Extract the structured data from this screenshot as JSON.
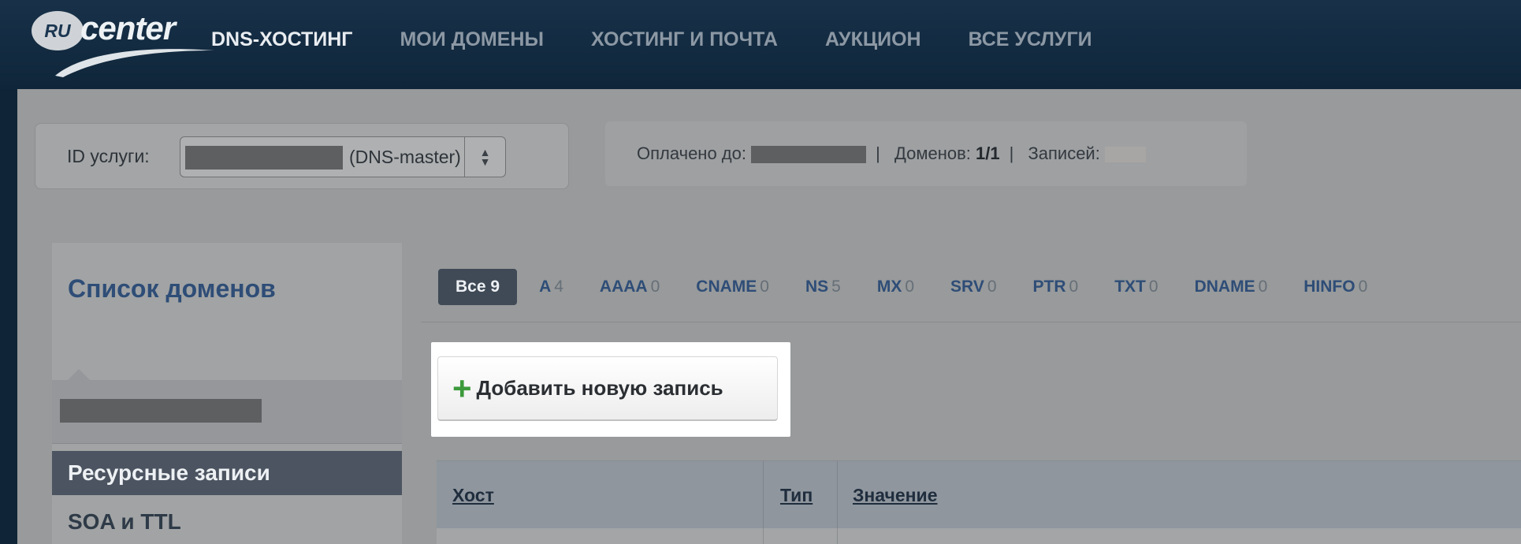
{
  "logo": {
    "badge": "RU",
    "word": "center"
  },
  "nav": {
    "items": [
      {
        "label": "DNS-ХОСТИНГ",
        "active": true
      },
      {
        "label": "МОИ ДОМЕНЫ",
        "active": false
      },
      {
        "label": "ХОСТИНГ И ПОЧТА",
        "active": false
      },
      {
        "label": "АУКЦИОН",
        "active": false
      },
      {
        "label": "ВСЕ УСЛУГИ",
        "active": false
      }
    ]
  },
  "service": {
    "label": "ID услуги:",
    "value_suffix": "(DNS-master)"
  },
  "info": {
    "paid_label": "Оплачено до:",
    "domains_label": "Доменов:",
    "domains_value": "1/1",
    "records_label": "Записей:"
  },
  "sidebar": {
    "title": "Список доменов",
    "menu": [
      {
        "label": "Ресурсные записи",
        "active": true
      },
      {
        "label": "SOA и TTL",
        "active": false
      }
    ]
  },
  "filters": {
    "active": {
      "name": "Все",
      "count": "9"
    },
    "items": [
      {
        "name": "A",
        "count": "4"
      },
      {
        "name": "AAAA",
        "count": "0"
      },
      {
        "name": "CNAME",
        "count": "0"
      },
      {
        "name": "NS",
        "count": "5"
      },
      {
        "name": "MX",
        "count": "0"
      },
      {
        "name": "SRV",
        "count": "0"
      },
      {
        "name": "PTR",
        "count": "0"
      },
      {
        "name": "TXT",
        "count": "0"
      },
      {
        "name": "DNAME",
        "count": "0"
      },
      {
        "name": "HINFO",
        "count": "0"
      }
    ]
  },
  "add_record": {
    "label": "Добавить новую запись",
    "icon": "plus-icon"
  },
  "table": {
    "columns": [
      "Хост",
      "Тип",
      "Значение"
    ]
  },
  "colors": {
    "nav_bg": "#0f263a",
    "accent_blue": "#2e4d77",
    "active_filter_bg": "#3f4a56",
    "plus_green": "#3c9a3c"
  }
}
